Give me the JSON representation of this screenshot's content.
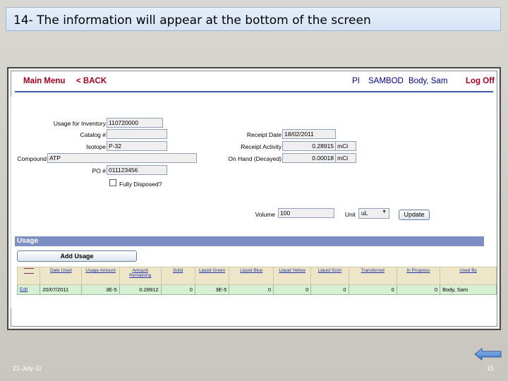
{
  "slide": {
    "title": "14- The information will appear at the bottom of the screen",
    "footer_date": "21-July-11",
    "slide_number": "15"
  },
  "nav": {
    "main_menu": "Main Menu",
    "back": "< BACK",
    "pi": "PI",
    "pi_code": "SAMBOD",
    "user": "Body, Sam",
    "log_off": "Log Off"
  },
  "form": {
    "usage_for_inventory_label": "Usage for Inventory",
    "usage_for_inventory_value": "110720000",
    "catalog_label": "Catalog #",
    "catalog_value": "",
    "isotope_label": "Isotope",
    "isotope_value": "P-32",
    "compound_label": "Compound",
    "compound_value": "ATP",
    "po_label": "PO #",
    "po_value": "011123456",
    "fully_disposed_label": "Fully Disposed?",
    "receipt_date_label": "Receipt Date",
    "receipt_date_value": "18/02/2011",
    "receipt_activity_label": "Receipt Activity",
    "receipt_activity_value": "0.28915",
    "receipt_activity_unit": "mCi",
    "on_hand_label": "On Hand (Decayed)",
    "on_hand_value": "0.00018",
    "on_hand_unit": "mCi",
    "volume_label": "Volume",
    "volume_value": "100",
    "unit_label": "Unit",
    "unit_value": "uL",
    "update_label": "Update"
  },
  "usage": {
    "section_title": "Usage",
    "add_usage_label": "Add Usage",
    "columns": [
      "Date Used",
      "Usage Amount",
      "Amount Remaining",
      "Solid",
      "Liquid Green",
      "Liquid Blue",
      "Liquid Yellow",
      "Liquid Scint",
      "Transferred",
      "In Progress",
      "Used By"
    ],
    "rows": [
      {
        "edit": "Edit",
        "date_used": "20/07/2011",
        "usage_amount": "3E-5",
        "amount_remaining": "0.28912",
        "solid": "0",
        "liquid_green": "3E-5",
        "liquid_blue": "0",
        "liquid_yellow": "0",
        "liquid_scint": "0",
        "transferred": "0",
        "in_progress": "0",
        "used_by": "Body, Sam"
      }
    ]
  },
  "colors": {
    "nav_red": "#a0001e",
    "usage_bar": "#7d8ec2",
    "header_row": "#ede6c8",
    "data_row": "#d7efd3"
  },
  "icons": {
    "back_arrow": "left-arrow-icon",
    "menu": "menu-icon"
  }
}
